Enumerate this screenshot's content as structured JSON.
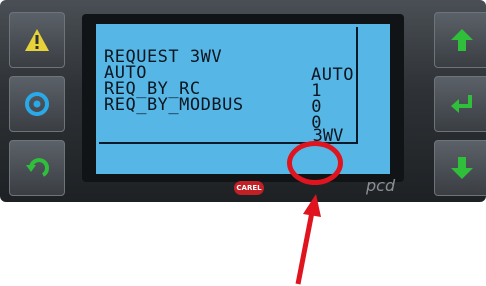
{
  "colors": {
    "led_green": "#2fbf3a",
    "led_blue": "#2aa9e8",
    "led_yellow": "#e8d23a",
    "screen_bg": "#56b7e7",
    "annotation_red": "#e0141e"
  },
  "left_buttons": [
    {
      "icon": "alarm-icon"
    },
    {
      "icon": "program-icon"
    },
    {
      "icon": "escape-icon"
    }
  ],
  "right_buttons": [
    {
      "icon": "up-arrow-icon"
    },
    {
      "icon": "enter-icon"
    },
    {
      "icon": "down-arrow-icon"
    }
  ],
  "lcd": {
    "rows": [
      {
        "label": "REQUEST 3WV",
        "value": "AUTO"
      },
      {
        "label": "AUTO",
        "value": "1"
      },
      {
        "label": "REQ_BY_RC",
        "value": "0"
      },
      {
        "label": "REQ_BY_MODBUS",
        "value": "0"
      }
    ],
    "screen_tag": "3WV"
  },
  "brand": {
    "logo": "CAREL",
    "model": "pcd"
  },
  "outside_text": ":"
}
